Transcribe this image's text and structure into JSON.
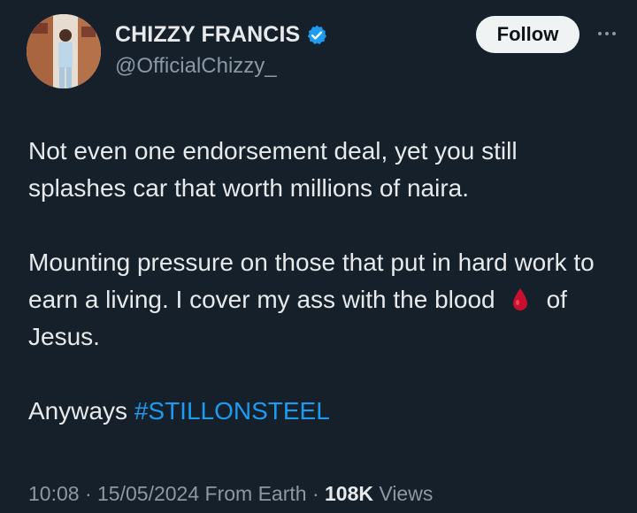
{
  "user": {
    "display_name": "CHIZZY FRANCIS",
    "handle": "@OfficialChizzy_"
  },
  "actions": {
    "follow_label": "Follow"
  },
  "tweet": {
    "line1": "Not even one endorsement deal, yet you still",
    "line2": "splashes car that worth millions of naira.",
    "p2_text_start": "Mounting pressure on those that put in hard work to earn a living. I cover my ass with the blood",
    "p2_text_end": "of Jesus.",
    "p3_text": "Anyways ",
    "hashtag": "#STILLONSTEEL"
  },
  "meta": {
    "time": "10:08",
    "separator": "·",
    "date": "15/05/2024",
    "source": "From Earth",
    "views_count": "108K",
    "views_label": "Views"
  },
  "colors": {
    "background": "#15202b",
    "text": "#e7e9ea",
    "muted": "#8b98a5",
    "link": "#1d9bf0",
    "verified": "#1d9bf0",
    "blood_drop": "#c8102e"
  },
  "icons": {
    "verified": "verified-badge-icon",
    "more": "more-options-icon",
    "drop": "drop-of-blood-emoji"
  }
}
